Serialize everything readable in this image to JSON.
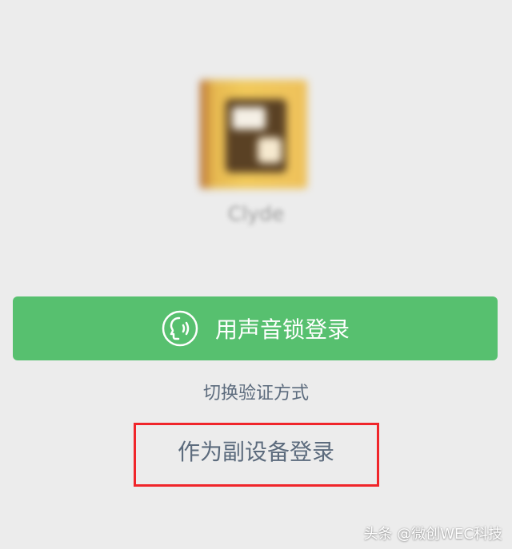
{
  "profile": {
    "nickname": "Clyde",
    "avatar_icon": "blurred-profile-photo"
  },
  "voice_login": {
    "label": "用声音锁登录",
    "icon": "voice-lock-icon"
  },
  "links": {
    "switch_verification": "切换验证方式",
    "secondary_device_login": "作为副设备登录"
  },
  "watermark": {
    "text": "头条 @微创WEC科技"
  },
  "colors": {
    "background": "#ececec",
    "primary_button": "#57c06f",
    "link_text": "#5c6b7d",
    "highlight_border": "#f0252a"
  }
}
